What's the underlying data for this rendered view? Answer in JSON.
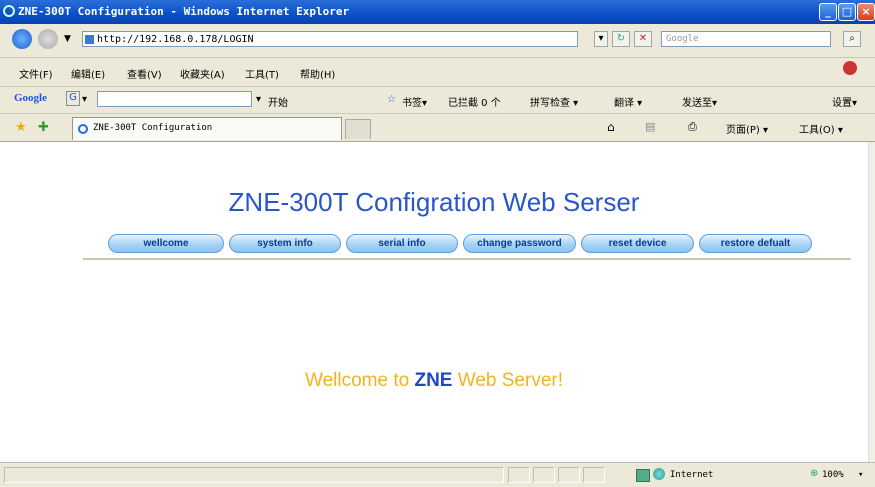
{
  "window": {
    "title": "ZNE-300T Configuration - Windows Internet Explorer"
  },
  "address": {
    "url": "http://192.168.0.178/LOGIN",
    "search_placeholder": "Google"
  },
  "menubar": [
    "文件(F)",
    "编辑(E)",
    "查看(V)",
    "收藏夹(A)",
    "工具(T)",
    "帮助(H)"
  ],
  "google_toolbar": {
    "logo": "Google",
    "start": "开始",
    "bookmarks": "书签▾",
    "blocked": "已拦截 0 个",
    "spellcheck": "拼写检查 ▾",
    "translate": "翻译 ▾",
    "sendto": "发送至▾",
    "settings": "设置▾"
  },
  "tab": {
    "title": "ZNE-300T Configuration",
    "page_menu": "页面(P) ▾",
    "tools_menu": "工具(O) ▾"
  },
  "page": {
    "heading": "ZNE-300T Configration Web Serser",
    "nav": [
      "wellcome",
      "system info",
      "serial info",
      "change password",
      "reset device",
      "restore defualt"
    ],
    "welcome_prefix": "Wellcome to ",
    "welcome_brand": "ZNE",
    "welcome_suffix": " Web Server!"
  },
  "status": {
    "zone": "Internet",
    "zoom": "100%"
  },
  "colors": {
    "heading": "#2956c8",
    "welcome": "#f4b21e",
    "brand": "#1e48c8"
  }
}
